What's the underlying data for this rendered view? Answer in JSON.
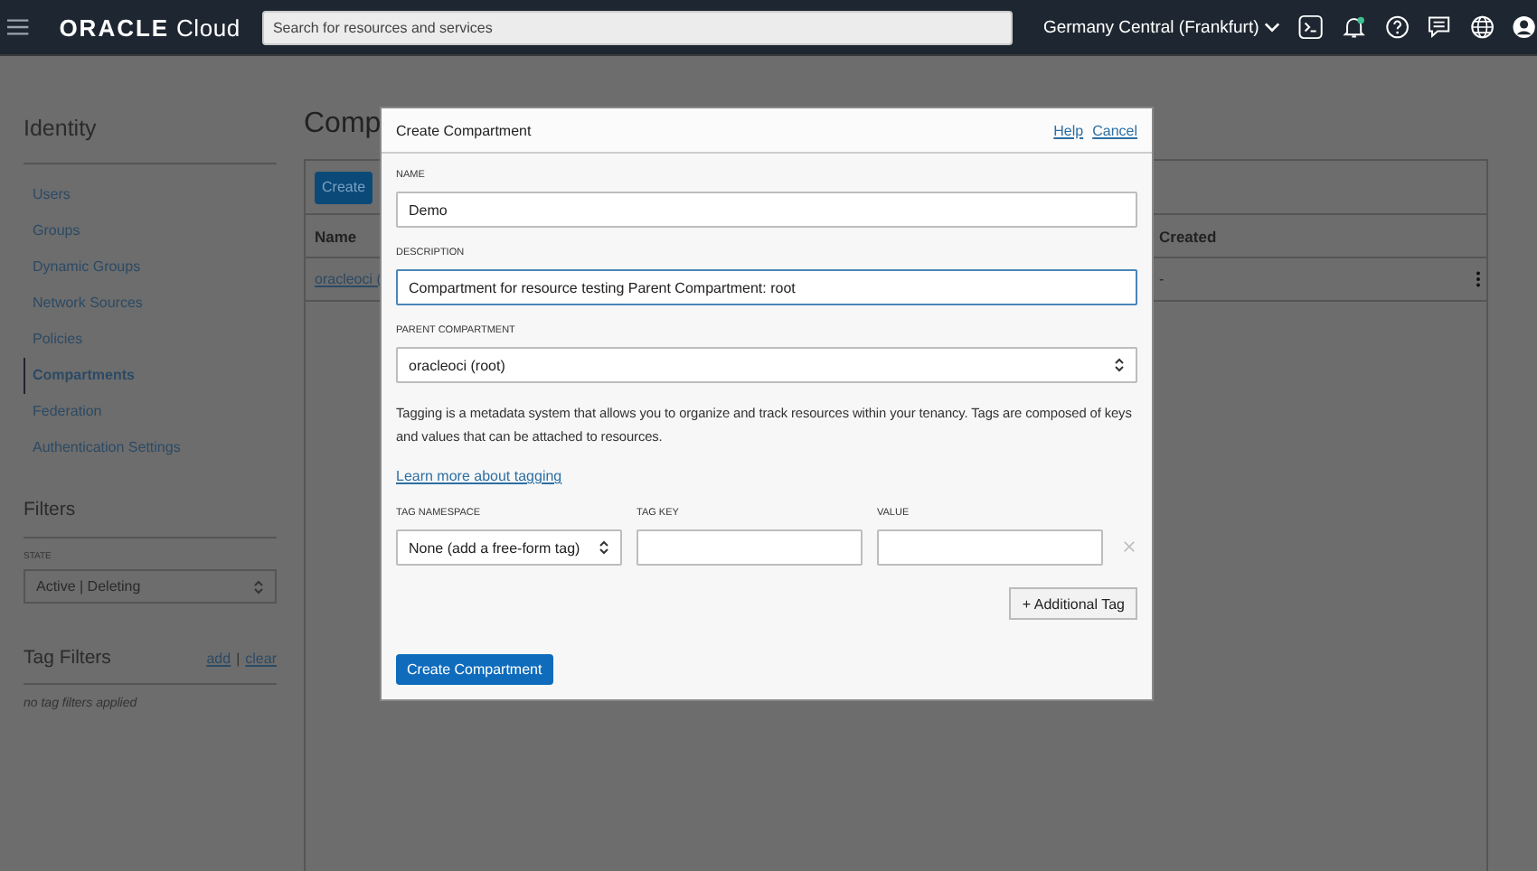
{
  "header": {
    "logo": {
      "brand": "ORACLE",
      "product": "Cloud"
    },
    "search": {
      "placeholder": "Search for resources and services"
    },
    "region": "Germany Central (Frankfurt)",
    "notification_dot": true
  },
  "sidebar": {
    "title": "Identity",
    "items": [
      {
        "label": "Users",
        "selected": false
      },
      {
        "label": "Groups",
        "selected": false
      },
      {
        "label": "Dynamic Groups",
        "selected": false
      },
      {
        "label": "Network Sources",
        "selected": false
      },
      {
        "label": "Policies",
        "selected": false
      },
      {
        "label": "Compartments",
        "selected": true
      },
      {
        "label": "Federation",
        "selected": false
      },
      {
        "label": "Authentication Settings",
        "selected": false
      }
    ],
    "filters": {
      "title": "Filters",
      "state_label": "STATE",
      "state_value": "Active | Deleting"
    },
    "tag_filters": {
      "title": "Tag Filters",
      "add": "add",
      "separator": "|",
      "clear": "clear",
      "empty": "no tag filters applied"
    }
  },
  "main": {
    "title": "Comp",
    "create_button": "Create",
    "columns": [
      "Name",
      "Created"
    ],
    "rows": [
      {
        "name": "oracleoci (",
        "created": "-"
      }
    ]
  },
  "dialog": {
    "title": "Create Compartment",
    "help": "Help",
    "cancel": "Cancel",
    "name": {
      "label": "NAME",
      "value": "Demo"
    },
    "description": {
      "label": "DESCRIPTION",
      "value": "Compartment for resource testing Parent Compartment: root",
      "focused": true
    },
    "parent": {
      "label": "PARENT COMPARTMENT",
      "value": "oracleoci (root)"
    },
    "tagging_text": "Tagging is a metadata system that allows you to organize and track resources within your tenancy. Tags are composed of keys and values that can be attached to resources.",
    "learn_more": "Learn more about tagging",
    "tag": {
      "namespace_label": "TAG NAMESPACE",
      "key_label": "TAG KEY",
      "value_label": "VALUE",
      "namespace_value": "None (add a free-form tag)"
    },
    "additional_tag_button": "+ Additional Tag",
    "submit_button": "Create Compartment"
  }
}
